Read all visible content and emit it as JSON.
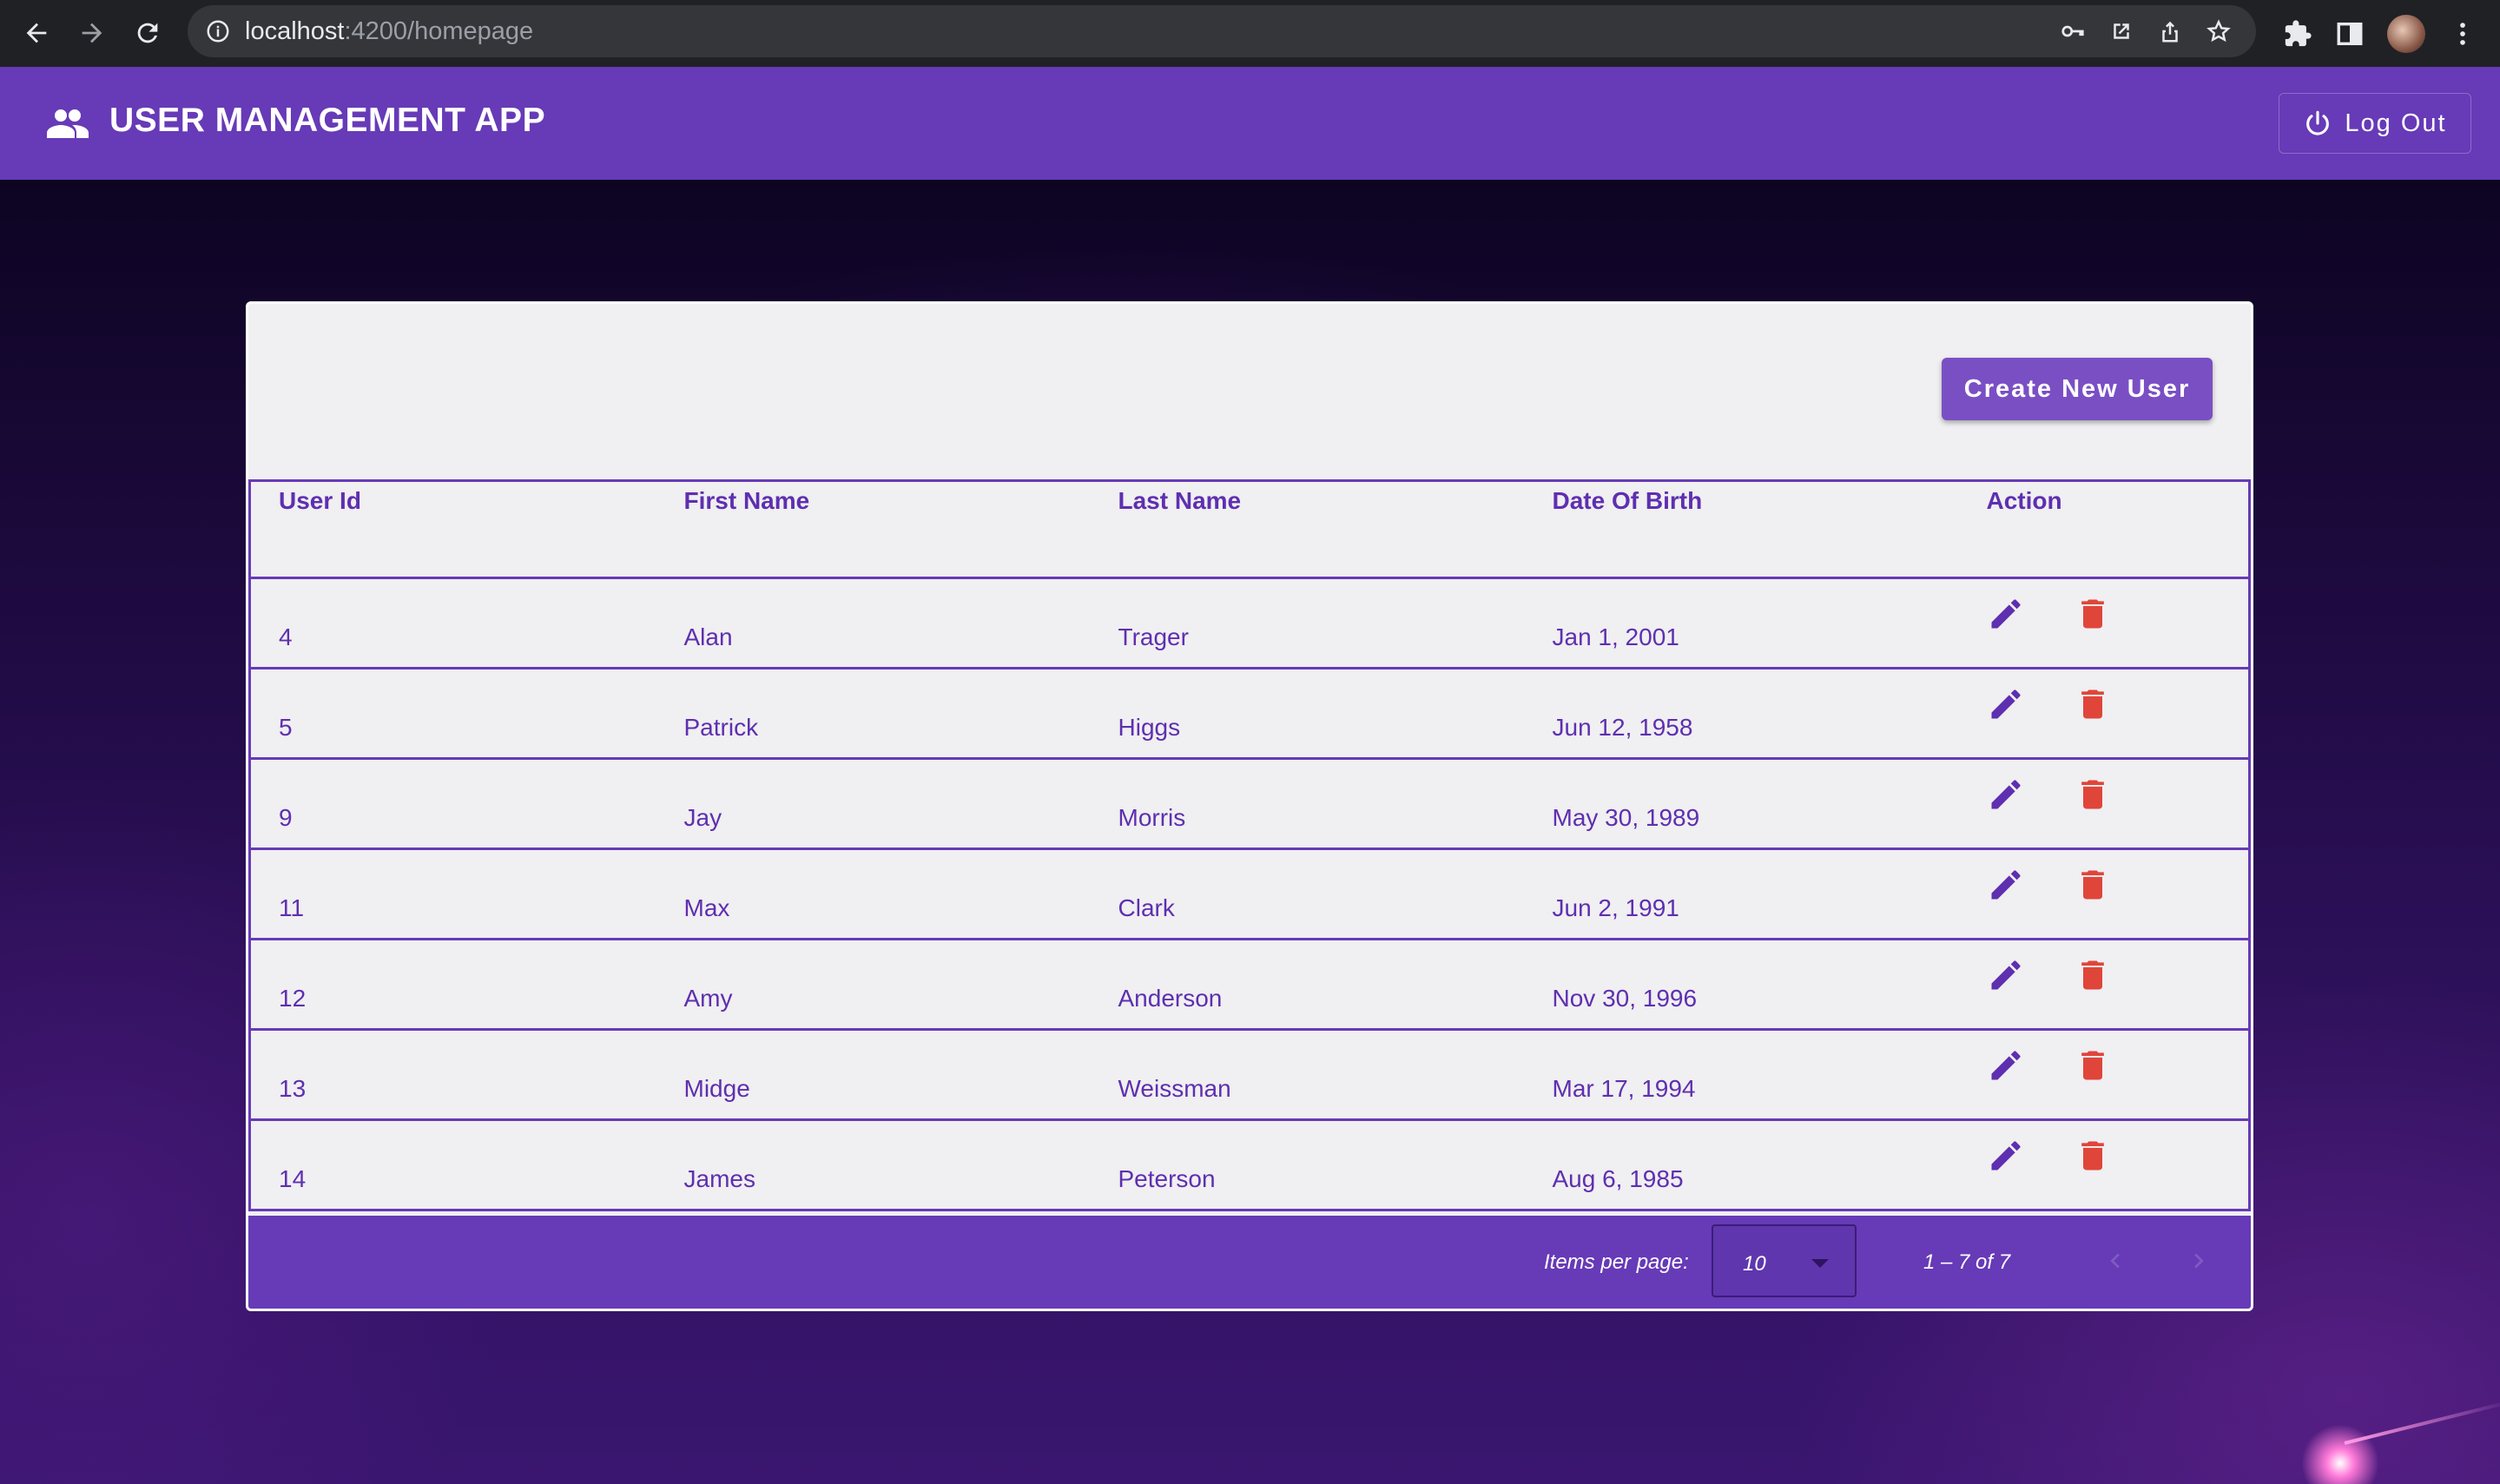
{
  "browser": {
    "url_host": "localhost",
    "url_path": ":4200/homepage"
  },
  "app": {
    "title": "USER MANAGEMENT APP",
    "logout_label": "Log Out",
    "brand_color": "#673ab7"
  },
  "toolbar": {
    "create_label": "Create New User"
  },
  "table": {
    "headers": [
      "User Id",
      "First Name",
      "Last Name",
      "Date Of Birth",
      "Action"
    ],
    "rows": [
      {
        "id": "4",
        "first": "Alan",
        "last": "Trager",
        "dob": "Jan 1, 2001"
      },
      {
        "id": "5",
        "first": "Patrick",
        "last": "Higgs",
        "dob": "Jun 12, 1958"
      },
      {
        "id": "9",
        "first": "Jay",
        "last": "Morris",
        "dob": "May 30, 1989"
      },
      {
        "id": "11",
        "first": "Max",
        "last": "Clark",
        "dob": "Jun 2, 1991"
      },
      {
        "id": "12",
        "first": "Amy",
        "last": "Anderson",
        "dob": "Nov 30, 1996"
      },
      {
        "id": "13",
        "first": "Midge",
        "last": "Weissman",
        "dob": "Mar 17, 1994"
      },
      {
        "id": "14",
        "first": "James",
        "last": "Peterson",
        "dob": "Aug 6, 1985"
      }
    ],
    "edit_icon": "pencil-icon",
    "delete_icon": "trash-icon",
    "edit_color": "#5e2fb0",
    "delete_color": "#e0453a"
  },
  "paginator": {
    "items_per_page_label": "Items per page:",
    "items_per_page_value": "10",
    "range_label": "1 – 7 of 7"
  }
}
